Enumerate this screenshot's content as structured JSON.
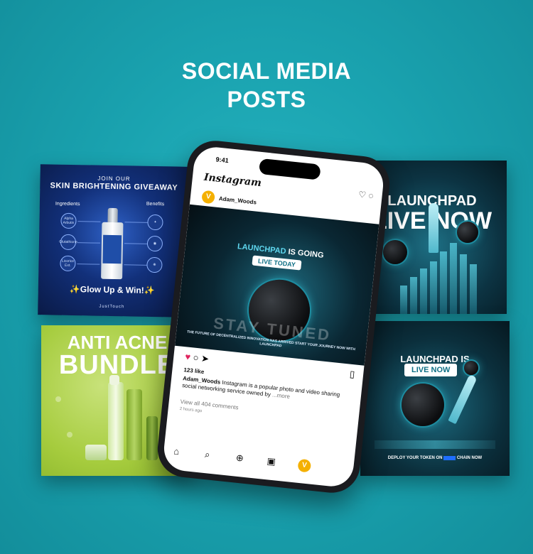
{
  "page": {
    "title_line1": "SOCIAL MEDIA",
    "title_line2": "POSTS"
  },
  "skin_card": {
    "header_small": "JOIN OUR",
    "header_main": "SKIN BRIGHTENING GIVEAWAY",
    "ingredients_label": "Ingredients",
    "benefits_label": "Benefits",
    "ingredients": [
      "Alpha Arbutin",
      "Glutathione",
      "Licorice Ext."
    ],
    "cta": "✨Glow Up & Win!✨",
    "brand": "JustTouch"
  },
  "acne_card": {
    "line1": "ANTI ACNE",
    "line2": "BUNDLE"
  },
  "launch_card_1": {
    "line1": "LAUNCHPAD",
    "line2": "LIVE NOW"
  },
  "launch_card_2": {
    "line1": "LAUNCHPAD IS",
    "pill": "LIVE NOW",
    "footer_prefix": "DEPLOY YOUR TOKEN ON",
    "footer_suffix": "CHAIN NOW"
  },
  "phone": {
    "time": "9:41",
    "app_name": "Instagram",
    "avatar_letter": "V",
    "username": "Adam_Woods",
    "post": {
      "line1_a": "LAUNCHPAD",
      "line1_b": " IS GOING",
      "pill": "LIVE TODAY",
      "watermark": "STAY TUNED",
      "small_text": "THE FUTURE OF DECENTRALIZED INNOVATION HAS ARRIVED START YOUR JOURNEY NOW WITH LAUNCHPAD"
    },
    "likes": "123 like",
    "caption_user": "Adam_Woods",
    "caption_text": "Instagram is a popular photo and video sharing social networking service owned by",
    "more": "...more",
    "view_comments": "View all 404 comments",
    "time_ago": "2 hours ago"
  }
}
